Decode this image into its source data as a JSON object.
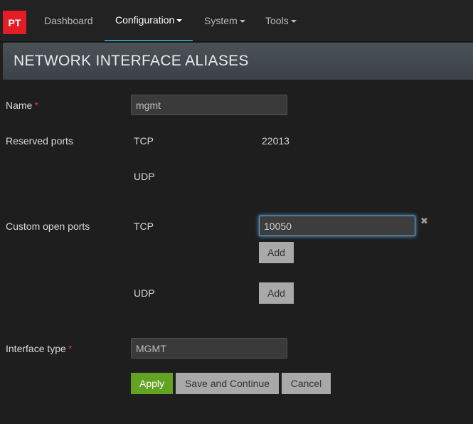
{
  "navbar": {
    "logo_text": "PT",
    "items": [
      {
        "label": "Dashboard",
        "dropdown": false,
        "active": false
      },
      {
        "label": "Configuration",
        "dropdown": true,
        "active": true
      },
      {
        "label": "System",
        "dropdown": true,
        "active": false
      },
      {
        "label": "Tools",
        "dropdown": true,
        "active": false
      }
    ]
  },
  "page": {
    "title": "NETWORK INTERFACE ALIASES"
  },
  "form": {
    "name": {
      "label": "Name",
      "required_mark": "*",
      "value": "mgmt"
    },
    "reserved_ports": {
      "label": "Reserved ports",
      "tcp_label": "TCP",
      "tcp_value": "22013",
      "udp_label": "UDP"
    },
    "custom_open_ports": {
      "label": "Custom open ports",
      "tcp_label": "TCP",
      "tcp_value": "10050",
      "remove_symbol": "✖",
      "add_label": "Add",
      "udp_label": "UDP"
    },
    "interface_type": {
      "label": "Interface type",
      "required_mark": "*",
      "value": "MGMT"
    },
    "buttons": {
      "apply": "Apply",
      "save_continue": "Save and Continue",
      "cancel": "Cancel"
    }
  },
  "colors": {
    "accent_red": "#e41c24",
    "apply_green": "#62a324",
    "focus_blue": "#5ea4d6"
  }
}
